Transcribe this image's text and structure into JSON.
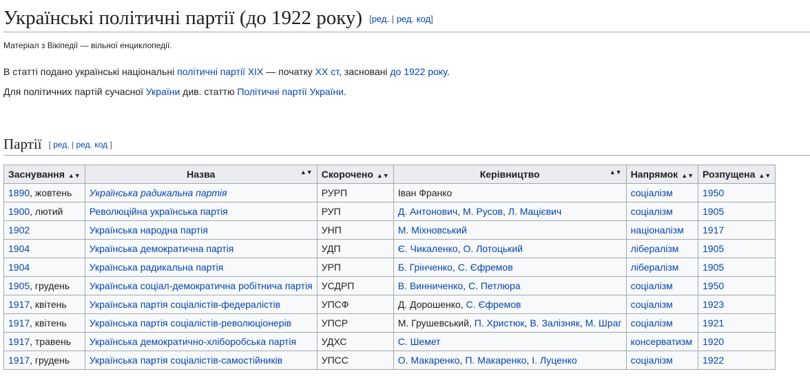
{
  "title": "Українські політичні партії (до 1922 року)",
  "edit": "ред.",
  "edit_code": "ред. код",
  "tagline": "Матеріал з Вікіпедії — вільної енциклопедії.",
  "intro": {
    "t1": "В статті подано українські національні ",
    "l1": "політичні партії",
    "l2": "XIX",
    "t2": " — початку ",
    "l3": "XX ст",
    "t3": ", засновані ",
    "l4": "до 1922 року",
    "t4": "."
  },
  "intro2": {
    "t1": "Для політичних партій сучасної ",
    "l1": "України",
    "t2": " див. статтю ",
    "l2": "Політичні партії України",
    "t3": "."
  },
  "section_title": "Партії",
  "table": {
    "headers": [
      "Заснування",
      "Назва",
      "Скорочено",
      "Керівництво",
      "Напрямок",
      "Розпущена"
    ],
    "rows": [
      {
        "year": "1890",
        "month": ", жовтень",
        "name": "Українська радикальна партія",
        "italic": true,
        "abbr": "РУРП",
        "leaders": [
          {
            "t": "Іван Франко",
            "link": false
          }
        ],
        "dir": "соціалізм",
        "end": "1950"
      },
      {
        "year": "1900",
        "month": ", лютий",
        "name": "Революційна українська партія",
        "italic": false,
        "abbr": "РУП",
        "leaders": [
          {
            "t": "Д. Антонович",
            "link": true
          },
          {
            "t": ", ",
            "link": false
          },
          {
            "t": "М. Русов",
            "link": true
          },
          {
            "t": ", ",
            "link": false
          },
          {
            "t": "Л. Мацієвич",
            "link": true
          }
        ],
        "dir": "соціалізм",
        "end": "1905"
      },
      {
        "year": "1902",
        "month": "",
        "name": "Українська народна партія",
        "italic": false,
        "abbr": "УНП",
        "leaders": [
          {
            "t": "М. Міхновський",
            "link": true
          }
        ],
        "dir": "націоналізм",
        "end": "1917"
      },
      {
        "year": "1904",
        "month": "",
        "name": "Українська демократична партія",
        "italic": false,
        "abbr": "УДП",
        "leaders": [
          {
            "t": "Є. Чикаленко",
            "link": true
          },
          {
            "t": ", ",
            "link": false
          },
          {
            "t": "О. Лотоцький",
            "link": true
          }
        ],
        "dir": "лібералізм",
        "end": "1905"
      },
      {
        "year": "1904",
        "month": "",
        "name": "Українська радикальна партія",
        "italic": false,
        "abbr": "УРП",
        "leaders": [
          {
            "t": "Б. Грінченко",
            "link": true
          },
          {
            "t": ", ",
            "link": false
          },
          {
            "t": "С. Єфремов",
            "link": true
          }
        ],
        "dir": "лібералізм",
        "end": "1905"
      },
      {
        "year": "1905",
        "month": ", грудень",
        "name": "Українська соціал-демократична робітнича партія",
        "italic": false,
        "abbr": "УСДРП",
        "leaders": [
          {
            "t": "В. Винниченко",
            "link": true
          },
          {
            "t": ", ",
            "link": false
          },
          {
            "t": "С. Петлюра",
            "link": true
          }
        ],
        "dir": "соціалізм",
        "end": "1950"
      },
      {
        "year": "1917",
        "month": ", квітень",
        "name": "Українська партія соціалістів-федералістів",
        "italic": false,
        "abbr": "УПСФ",
        "leaders": [
          {
            "t": "Д. Дорошенко",
            "link": false
          },
          {
            "t": ", ",
            "link": false
          },
          {
            "t": "С. Єфремов",
            "link": true
          }
        ],
        "dir": "соціалізм",
        "end": "1923"
      },
      {
        "year": "1917",
        "month": ", квітень",
        "name": "Українська партія соціалістів-революціонерів",
        "italic": false,
        "abbr": "УПСР",
        "leaders": [
          {
            "t": "М. Грушевський",
            "link": false
          },
          {
            "t": ", ",
            "link": false
          },
          {
            "t": "П. Христюк",
            "link": true
          },
          {
            "t": ", ",
            "link": false
          },
          {
            "t": "В. Залізняк",
            "link": true
          },
          {
            "t": ", ",
            "link": false
          },
          {
            "t": "М. Шраг",
            "link": true
          }
        ],
        "dir": "соціалізм",
        "end": "1921"
      },
      {
        "year": "1917",
        "month": ", травень",
        "name": "Українська демократично-хліборобська партія",
        "italic": false,
        "abbr": "УДХС",
        "leaders": [
          {
            "t": "С. Шемет",
            "link": true
          }
        ],
        "dir": "консерватизм",
        "end": "1920"
      },
      {
        "year": "1917",
        "month": ", грудень",
        "name": "Українська партія соціалістів-самостійників",
        "italic": false,
        "abbr": "УПСС",
        "leaders": [
          {
            "t": "О. Макаренко",
            "link": true
          },
          {
            "t": ", ",
            "link": false
          },
          {
            "t": "П. Макаренко",
            "link": true
          },
          {
            "t": ", ",
            "link": false
          },
          {
            "t": "І. Луценко",
            "link": true
          }
        ],
        "dir": "соціалізм",
        "end": "1922"
      }
    ]
  }
}
